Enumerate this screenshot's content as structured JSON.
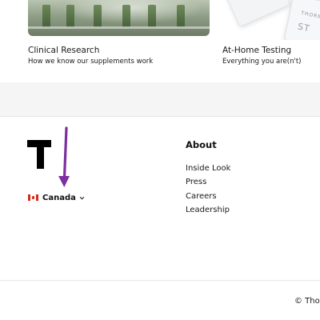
{
  "cards": [
    {
      "title": "Clinical Research",
      "subtitle": "How we know our supplements work"
    },
    {
      "title": "At-Home Testing",
      "subtitle": "Everything you are(n't)"
    }
  ],
  "product_image": {
    "brand_small": "THORNE",
    "brand_large": "ST"
  },
  "country_selector": {
    "label": "Canada",
    "flag_icon": "canada-flag-icon",
    "chevron_icon": "chevron-down-icon"
  },
  "annotation_arrow": {
    "color": "#7b2fa0"
  },
  "about": {
    "title": "About",
    "links": [
      "Inside Look",
      "Press",
      "Careers",
      "Leadership"
    ]
  },
  "footer": {
    "copyright": "© Thor"
  },
  "colors": {
    "band": "#f5f5f5",
    "divider": "#e6e6e6",
    "text": "#1a1a1a"
  }
}
